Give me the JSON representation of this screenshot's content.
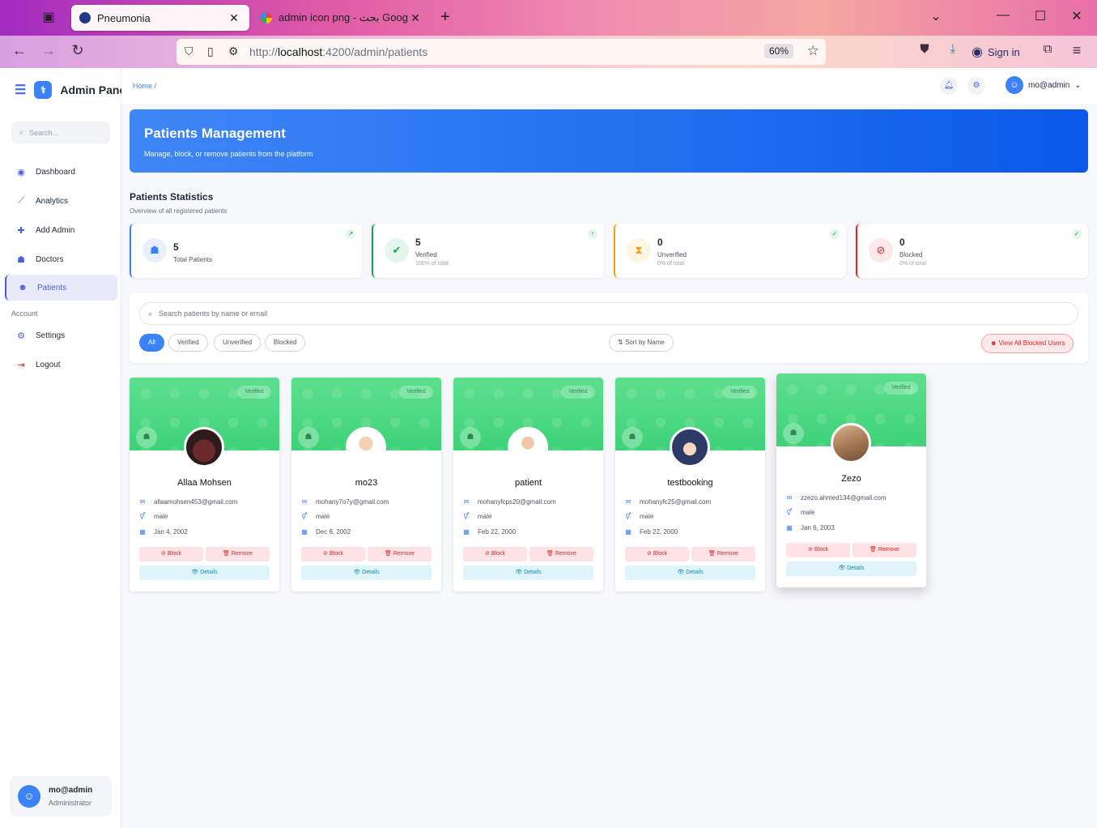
{
  "browser": {
    "tabs": [
      {
        "title": "Pneumonia",
        "active": true
      },
      {
        "title": "admin icon png - بحث Google",
        "active": false
      }
    ],
    "url_prefix": "http://",
    "url_host": "localhost",
    "url_path": ":4200/admin/patients",
    "zoom": "60%",
    "sign_in": "Sign in"
  },
  "sidebar": {
    "brand": "Admin Panel",
    "search_placeholder": "Search...",
    "items": [
      {
        "label": "Dashboard",
        "icon": "dashboard-icon"
      },
      {
        "label": "Analytics",
        "icon": "chart-line-icon"
      },
      {
        "label": "Add Admin",
        "icon": "user-plus-icon"
      },
      {
        "label": "Doctors",
        "icon": "doctor-icon"
      },
      {
        "label": "Patients",
        "icon": "users-icon",
        "active": true
      }
    ],
    "section_account": "Account",
    "account_items": [
      {
        "label": "Settings",
        "icon": "gear-icon"
      },
      {
        "label": "Logout",
        "icon": "logout-icon"
      }
    ],
    "user": {
      "name": "mo@admin",
      "role": "Administrator"
    }
  },
  "topbar": {
    "breadcrumb_home": "Home",
    "breadcrumb_sep": "/",
    "user": "mo@admin"
  },
  "banner": {
    "title": "Patients Management",
    "subtitle": "Manage, block, or remove patients from the platform"
  },
  "stats": {
    "title": "Patients Statistics",
    "subtitle": "Overview of all registered patients",
    "cards": [
      {
        "value": "5",
        "label": "Total Patients",
        "pct": "",
        "color": "#3b82f6"
      },
      {
        "value": "5",
        "label": "Verified",
        "pct": "100% of total",
        "color": "#16a34a"
      },
      {
        "value": "0",
        "label": "Unverified",
        "pct": "0% of total",
        "color": "#f59e0b"
      },
      {
        "value": "0",
        "label": "Blocked",
        "pct": "0% of total",
        "color": "#dc2626"
      }
    ]
  },
  "filters": {
    "search_placeholder": "Search patients by name or email",
    "chips": [
      "All",
      "Verified",
      "Unverified",
      "Blocked"
    ],
    "sort": "Sort by Name",
    "view_blocked": "View All Blocked Users"
  },
  "patients": [
    {
      "name": "Allaa Mohsen",
      "email": "allaamohsen453@gmail.com",
      "gender": "male",
      "dob": "Jan 4, 2002",
      "badge": "Verified"
    },
    {
      "name": "mo23",
      "email": "mohany7o7y@gmail.com",
      "gender": "male",
      "dob": "Dec 6, 2002",
      "badge": "Verified"
    },
    {
      "name": "patient",
      "email": "mohanyfcps20@gmail.com",
      "gender": "male",
      "dob": "Feb 22, 2000",
      "badge": "Verified"
    },
    {
      "name": "testbooking",
      "email": "mohanyfc25@gmail.com",
      "gender": "male",
      "dob": "Feb 22, 2000",
      "badge": "Verified"
    },
    {
      "name": "Zezo",
      "email": "zzezo.ahmed134@gmail.com",
      "gender": "male",
      "dob": "Jan 6, 2003",
      "badge": "Verified"
    }
  ],
  "card_actions": {
    "block": "Block",
    "remove": "Remove",
    "details": "Details"
  }
}
